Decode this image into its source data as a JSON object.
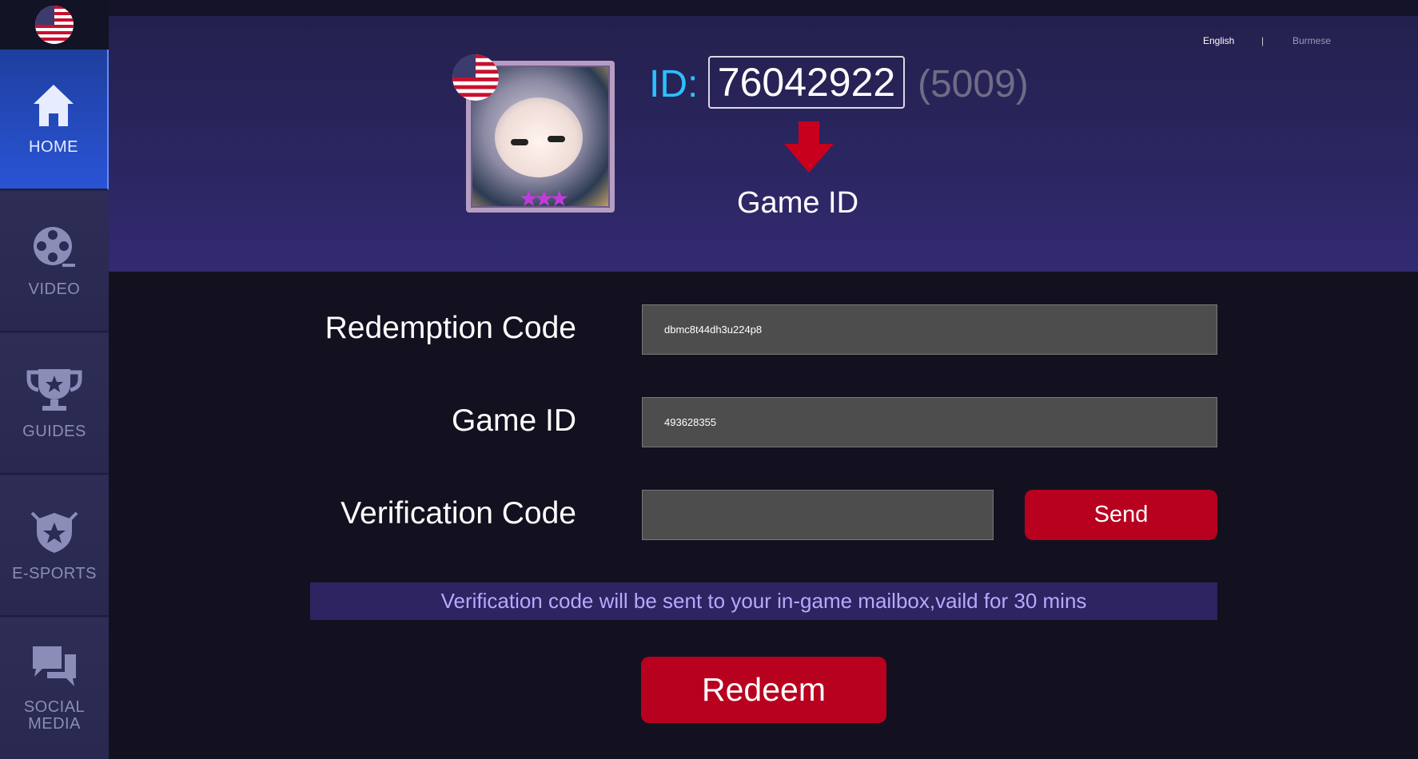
{
  "sidebar": {
    "flag_icon": "us-flag-icon",
    "items": [
      {
        "label": "HOME",
        "icon": "home-icon",
        "active": true
      },
      {
        "label": "VIDEO",
        "icon": "film-reel-icon",
        "active": false
      },
      {
        "label": "GUIDES",
        "icon": "trophy-icon",
        "active": false
      },
      {
        "label": "E-SPORTS",
        "icon": "shield-star-icon",
        "active": false
      },
      {
        "label_line1": "SOCIAL",
        "label_line2": "MEDIA",
        "icon": "chat-bubbles-icon",
        "active": false
      }
    ]
  },
  "language": {
    "english": "English",
    "separator": "|",
    "burmese": "Burmese"
  },
  "profile": {
    "id_label": "ID:",
    "id_value": "76042922",
    "zone": "(5009)",
    "caption": "Game ID",
    "arrow_icon": "down-arrow-icon"
  },
  "form": {
    "redemption_label": "Redemption Code",
    "redemption_value": "dbmc8t44dh3u224p8",
    "gameid_label": "Game ID",
    "gameid_value": "493628355",
    "verification_label": "Verification Code",
    "verification_value": "",
    "send_label": "Send",
    "notice": "Verification code will be sent to your in-game mailbox,vaild for 30 mins",
    "redeem_label": "Redeem"
  },
  "colors": {
    "accent_red": "#b8001f",
    "id_blue": "#2cc0ff",
    "notice_bg": "#2d2461",
    "notice_text": "#b9a8ff"
  }
}
